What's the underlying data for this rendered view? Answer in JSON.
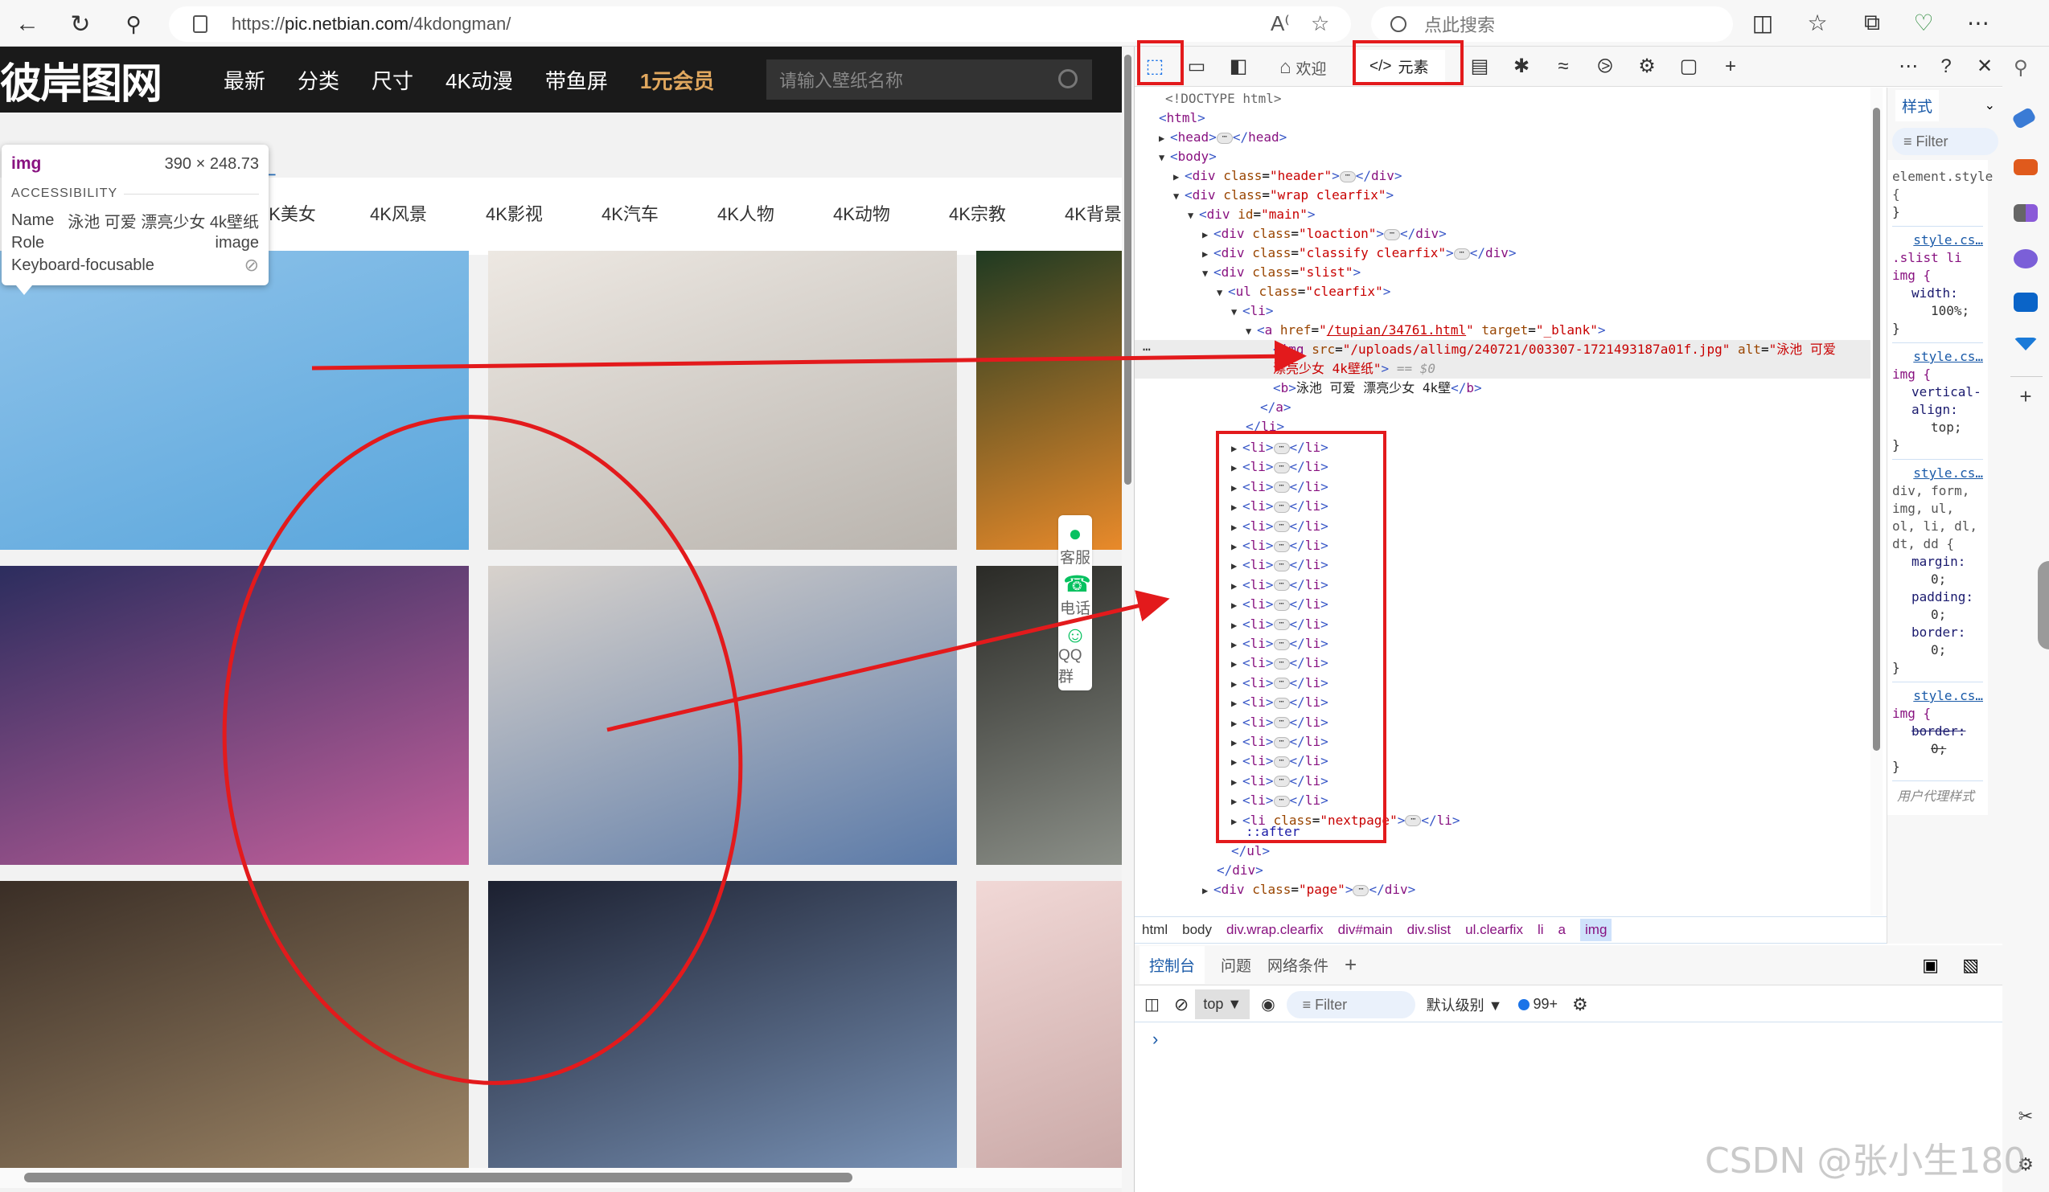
{
  "browser": {
    "url_prefix": "https://",
    "url_host": "pic.netbian.com",
    "url_path": "/4kdongman/",
    "search_placeholder": "点此搜索",
    "icons": [
      "back-icon",
      "refresh-icon",
      "search-icon",
      "lock-icon",
      "read-aloud-icon",
      "favorite-star-icon",
      "split-screen-icon",
      "favorites-icon",
      "collections-icon",
      "browser-essentials-icon",
      "more-icon",
      "sidebar-toggle-icon"
    ]
  },
  "site": {
    "logo": "彼岸图网",
    "nav": [
      "最新",
      "分类",
      "尺寸",
      "4K动漫",
      "带鱼屏",
      "1元会员"
    ],
    "search_placeholder": "请输入壁纸名称",
    "categories": [
      "4K美女",
      "4K风景",
      "4K影视",
      "4K汽车",
      "4K人物",
      "4K动物",
      "4K宗教",
      "4K背景"
    ],
    "side_widget": [
      {
        "label": "客服",
        "icon": "qq-service-icon"
      },
      {
        "label": "电话",
        "icon": "phone-icon"
      },
      {
        "label": "QQ群",
        "icon": "qq-group-icon"
      }
    ],
    "thumbnails": [
      {
        "alt": "泳池 可爱 漂亮少女 4k壁纸",
        "colors": [
          "#8fc3ea",
          "#5aa6dc"
        ]
      },
      {
        "alt": "",
        "colors": [
          "#ede8e2",
          "#b9b4ae"
        ]
      },
      {
        "alt": "",
        "colors": [
          "#1f3a22",
          "#e98a2a"
        ]
      },
      {
        "alt": "",
        "colors": [
          "#2c2d5e",
          "#c4609c"
        ]
      },
      {
        "alt": "",
        "colors": [
          "#d8d2cc",
          "#5b7aa8"
        ]
      },
      {
        "alt": "",
        "colors": [
          "#2a2a26",
          "#8b8f88"
        ]
      },
      {
        "alt": "",
        "colors": [
          "#3a2e26",
          "#a08868"
        ]
      },
      {
        "alt": "",
        "colors": [
          "#1c2030",
          "#7a94b8"
        ]
      },
      {
        "alt": "",
        "colors": [
          "#f1d8d6",
          "#c9a8a6"
        ]
      }
    ]
  },
  "tooltip": {
    "tag": "img",
    "size": "390 × 248.73",
    "section": "ACCESSIBILITY",
    "name_label": "Name",
    "name_value": "泳池 可爱 漂亮少女 4k壁纸",
    "role_label": "Role",
    "role_value": "image",
    "focus_label": "Keyboard-focusable",
    "focus_icon": "not-allowed-icon"
  },
  "devtools": {
    "tabs": [
      {
        "label": "欢迎",
        "icon": "home-icon"
      },
      {
        "label": "元素",
        "icon": "code-icon",
        "active": true
      }
    ],
    "toolbar_icons": [
      "inspect-element-icon",
      "device-emulation-icon",
      "dock-icon",
      "console-icon",
      "bug-icon",
      "network-wifi-icon",
      "performance-icon",
      "memory-chip-icon",
      "application-icon",
      "add-tab-icon",
      "more-icon",
      "help-icon",
      "close-icon"
    ],
    "dom": {
      "doctype": "<!DOCTYPE html>",
      "html": "html",
      "head": "head",
      "body": "body",
      "header_class": "header",
      "wrap_class": "wrap clearfix",
      "main_id": "main",
      "loaction_class": "loaction",
      "classify_class": "classify clearfix",
      "slist_class": "slist",
      "ul_class": "clearfix",
      "a_href": "/tupian/34761.html",
      "a_target": "_blank",
      "img_src": "/uploads/allimg/240721/003307-1721493187a01f.jpg",
      "img_alt": "泳池 可爱 漂亮少女 4k壁纸",
      "img_alt_line1": "泳池 可爱",
      "img_alt_line2": "漂亮少女 4k壁纸",
      "selected_marker": "== $0",
      "b_text": "泳池 可爱 漂亮少女 4k壁",
      "collapsed_li_count": 19,
      "nextpage_class": "nextpage",
      "after_pseudo": "::after",
      "page_class": "page"
    },
    "breadcrumb": [
      "html",
      "body",
      "div.wrap.clearfix",
      "div#main",
      "div.slist",
      "ul.clearfix",
      "li",
      "a",
      "img"
    ],
    "styles": {
      "tab_label": "样式",
      "filter_placeholder": "Filter",
      "rules": [
        {
          "source": "",
          "selector": "element.style {",
          "props": []
        },
        {
          "source": "style.cs…",
          "selector": ".slist li img {",
          "props": [
            {
              "name": "width:",
              "value": "100%;"
            }
          ]
        },
        {
          "source": "style.cs…",
          "selector": "img {",
          "props": [
            {
              "name": "vertical-align:",
              "value": "top;"
            }
          ]
        },
        {
          "source": "style.cs…",
          "selector": "div, form, img, ul, ol, li, dl, dt, dd {",
          "props": [
            {
              "name": "margin:",
              "value": "0;"
            },
            {
              "name": "padding:",
              "value": "0;"
            },
            {
              "name": "border:",
              "value": "0;"
            }
          ]
        },
        {
          "source": "style.cs…",
          "selector": "img {",
          "props": [
            {
              "name": "border:",
              "value": "0;",
              "struck": true
            }
          ]
        }
      ],
      "user_agent_label": "用户代理样式"
    },
    "drawer": {
      "tabs": [
        "控制台",
        "问题",
        "网络条件"
      ],
      "context": "top",
      "filter_placeholder": "Filter",
      "level": "默认级别",
      "message_count": "99+"
    }
  },
  "watermark": "CSDN @张小生180",
  "annotation_color": "#e31a1c"
}
